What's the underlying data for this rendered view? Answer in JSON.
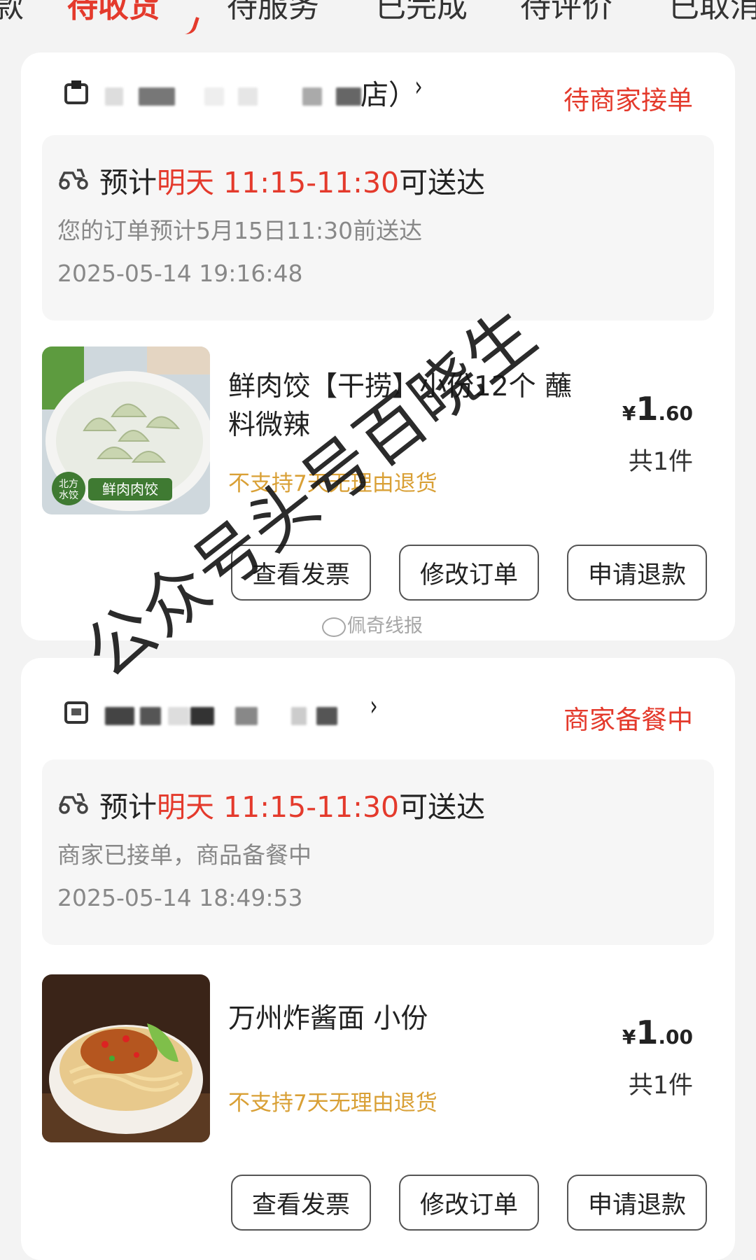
{
  "tabs": [
    {
      "label": "款"
    },
    {
      "label": "待收货",
      "active": true
    },
    {
      "label": "待服务"
    },
    {
      "label": "已完成"
    },
    {
      "label": "待评价"
    },
    {
      "label": "已取消"
    }
  ],
  "orders": [
    {
      "store_suffix": "店）",
      "status": "待商家接单",
      "eta_prefix": "预计",
      "eta_highlight": "明天 11:15-11:30",
      "eta_suffix": "可送达",
      "note": "您的订单预计5月15日11:30前送达",
      "time": "2025-05-14 19:16:48",
      "item_name": "鲜肉饺【干捞】小份12个 蘸料微辣",
      "thumb_caption": "鲜肉肉饺",
      "thumb_brand": "北方水饺",
      "policy": "不支持7天无理由退货",
      "currency": "¥",
      "price_int": "1",
      "price_dec": ".60",
      "qty": "共1件",
      "buttons": [
        "查看发票",
        "修改订单",
        "申请退款"
      ]
    },
    {
      "store_suffix": "",
      "status": "商家备餐中",
      "eta_prefix": "预计",
      "eta_highlight": "明天 11:15-11:30",
      "eta_suffix": "可送达",
      "note": "商家已接单，商品备餐中",
      "time": "2025-05-14 18:49:53",
      "item_name": "万州炸酱面 小份",
      "policy": "不支持7天无理由退货",
      "currency": "¥",
      "price_int": "1",
      "price_dec": ".00",
      "qty": "共1件",
      "buttons": [
        "查看发票",
        "修改订单",
        "申请退款"
      ]
    }
  ],
  "watermark": {
    "main": "公众号头号百晓生",
    "weibo": "佩奇线报"
  },
  "colors": {
    "accent": "#e43a2c",
    "policy": "#d9a036"
  }
}
